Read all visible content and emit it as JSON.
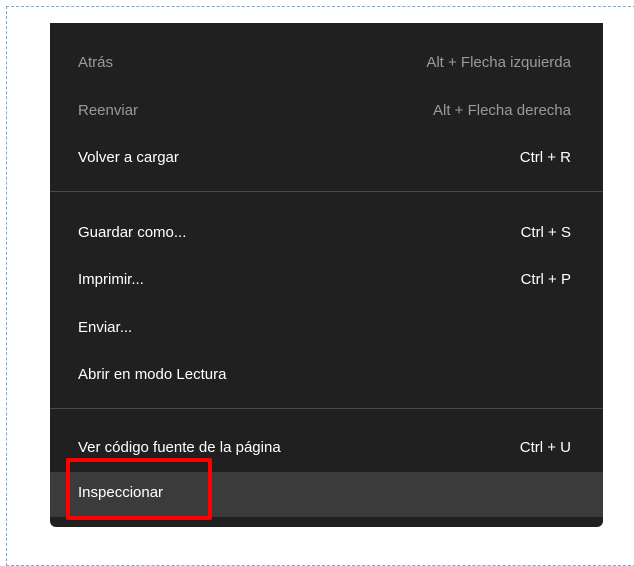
{
  "menu": {
    "items": [
      {
        "label": "Atrás",
        "shortcut": "Alt + Flecha izquierda",
        "state": "disabled"
      },
      {
        "label": "Reenviar",
        "shortcut": "Alt + Flecha derecha",
        "state": "disabled"
      },
      {
        "label": "Volver a cargar",
        "shortcut": "Ctrl + R",
        "state": "enabled"
      },
      {
        "label": "Guardar como...",
        "shortcut": "Ctrl + S",
        "state": "enabled"
      },
      {
        "label": "Imprimir...",
        "shortcut": "Ctrl + P",
        "state": "enabled"
      },
      {
        "label": "Enviar...",
        "shortcut": "",
        "state": "enabled"
      },
      {
        "label": "Abrir en modo Lectura",
        "shortcut": "",
        "state": "enabled"
      },
      {
        "label": "Ver código fuente de la página",
        "shortcut": "Ctrl + U",
        "state": "enabled"
      },
      {
        "label": "Inspeccionar",
        "shortcut": "",
        "state": "hovered"
      }
    ]
  },
  "colors": {
    "menu_background": "#202020",
    "hover_background": "#3b3b3b",
    "disabled_text": "#9a9a9a",
    "highlight": "#ff0000"
  }
}
